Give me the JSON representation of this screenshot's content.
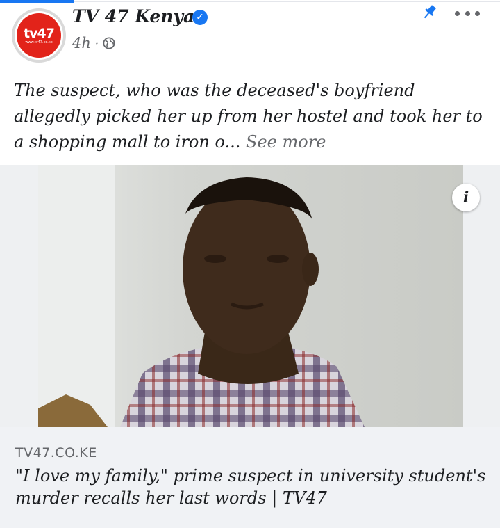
{
  "post": {
    "page_name": "TV 47 Kenya",
    "avatar": {
      "logo_text": "tv47",
      "logo_subtext": "www.tv47.co.ke"
    },
    "verified_icon": "check-badge-icon",
    "time": "4h",
    "separator": "·",
    "privacy_icon": "globe-icon",
    "caption": "The suspect, who was the deceased's boyfriend allegedly picked her up from her hostel and took her to a shopping mall to iron o...",
    "see_more": "See more",
    "info_label": "i"
  },
  "link": {
    "domain": "TV47.CO.KE",
    "title": "\"I love my family,\" prime suspect in university student's murder recalls her last words | TV47"
  },
  "colors": {
    "accent": "#1877f2",
    "brand_red": "#e2231a",
    "secondary_text": "#65676b",
    "card_background": "#f0f2f5"
  }
}
